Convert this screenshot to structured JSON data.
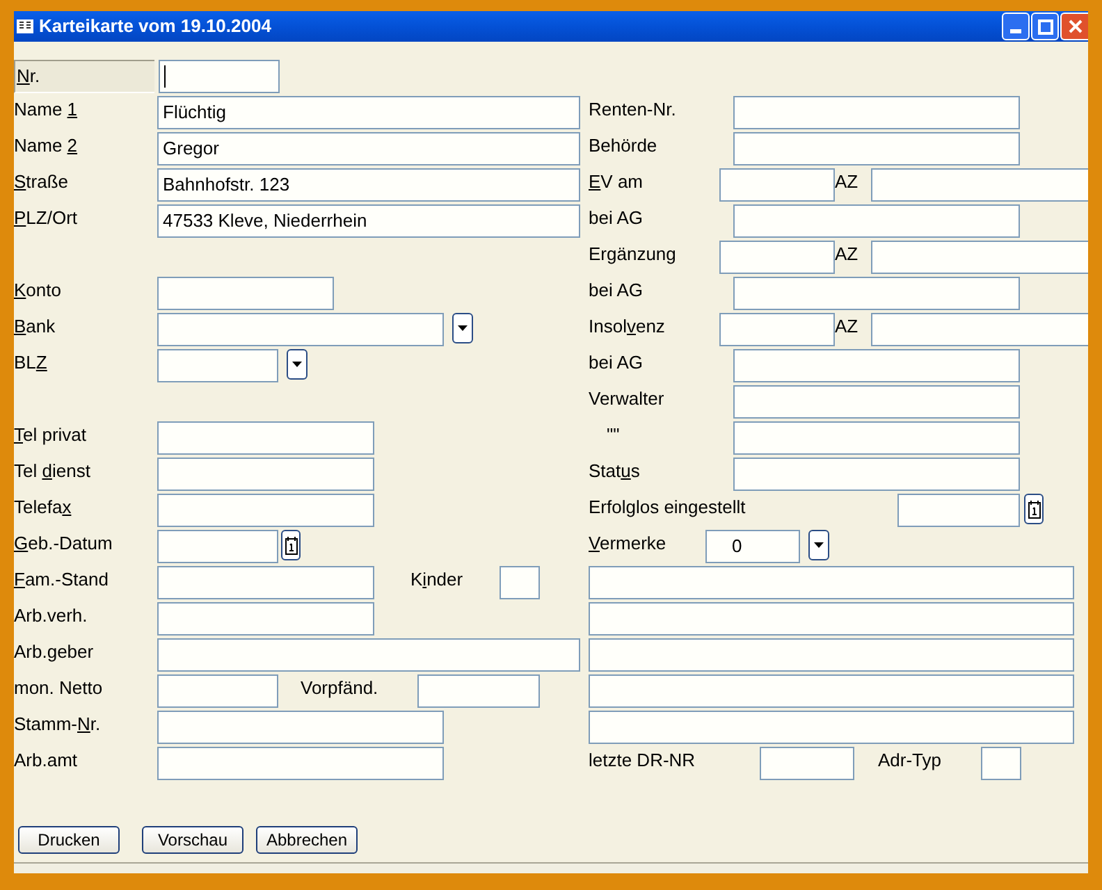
{
  "window": {
    "title": "Karteikarte vom 19.10.2004"
  },
  "left_groups": [
    [
      {
        "kind": "text",
        "label": {
          "key": "N",
          "post": "r."
        },
        "focused": true
      },
      {
        "kind": "text",
        "label": {
          "pre": "Name ",
          "key": "1"
        },
        "value": "Flüchtig"
      },
      {
        "kind": "text",
        "label": {
          "pre": "Name ",
          "key": "2"
        },
        "value": "Gregor"
      },
      {
        "kind": "text",
        "label": {
          "key": "S",
          "post": "traße"
        },
        "value": "Bahnhofstr. 123"
      },
      {
        "kind": "text",
        "label": {
          "key": "P",
          "post": "LZ/Ort"
        },
        "value": "47533 Kleve, Niederrhein"
      }
    ],
    [
      {
        "kind": "text",
        "label": {
          "key": "K",
          "post": "onto"
        }
      },
      {
        "kind": "dropdown",
        "label": {
          "key": "B",
          "post": "ank"
        }
      },
      {
        "kind": "dropdown",
        "label": {
          "pre": "BL",
          "key": "Z"
        }
      }
    ],
    [
      {
        "kind": "text",
        "label": {
          "key": "T",
          "post": "el privat"
        }
      },
      {
        "kind": "text",
        "label": {
          "pre": "Tel ",
          "key": "d",
          "post": "ienst"
        }
      },
      {
        "kind": "text",
        "label": {
          "pre": "Telefa",
          "key": "x"
        }
      },
      {
        "kind": "date",
        "label": {
          "key": "G",
          "post": "eb.-Datum"
        }
      },
      {
        "kind": "pair",
        "label": {
          "key": "F",
          "post": "am.-Stand"
        },
        "label2": {
          "pre": "K",
          "key": "i",
          "post": "nder"
        }
      },
      {
        "kind": "text",
        "label": {
          "pre": "Arb.verh."
        }
      },
      {
        "kind": "text",
        "label": {
          "pre": "Arb.geber"
        }
      },
      {
        "kind": "pair",
        "label": {
          "pre": "mon. Netto"
        },
        "label2": {
          "pre": "Vorpfänd."
        }
      },
      {
        "kind": "text",
        "label": {
          "pre": "Stamm-",
          "key": "N",
          "post": "r."
        }
      },
      {
        "kind": "text",
        "label": {
          "pre": "Arb.amt"
        }
      }
    ]
  ],
  "right_rows": [
    {
      "kind": "text",
      "label": {
        "pre": "Renten-Nr."
      }
    },
    {
      "kind": "text",
      "label": {
        "pre": "Behörde"
      }
    },
    {
      "kind": "az",
      "label": {
        "key": "E",
        "post": "V am"
      },
      "label2": {
        "pre": "AZ"
      }
    },
    {
      "kind": "text",
      "label": {
        "pre": "bei AG"
      }
    },
    {
      "kind": "az",
      "label": {
        "pre": "Ergänzung"
      },
      "label2": {
        "pre": "AZ"
      }
    },
    {
      "kind": "text",
      "label": {
        "pre": "bei AG"
      }
    },
    {
      "kind": "az",
      "label": {
        "pre": "Insol",
        "key": "v",
        "post": "enz"
      },
      "label2": {
        "pre": "AZ"
      }
    },
    {
      "kind": "text",
      "label": {
        "pre": "bei AG"
      }
    },
    {
      "kind": "text",
      "label": {
        "pre": "Verwalter"
      }
    },
    {
      "kind": "text",
      "label": {
        "pre": "\"\""
      }
    },
    {
      "kind": "text",
      "label": {
        "pre": "Stat",
        "key": "u",
        "post": "s"
      }
    },
    {
      "kind": "date",
      "label": {
        "pre": "Erfolglos eingestellt"
      }
    },
    {
      "kind": "dropdown",
      "label": {
        "key": "V",
        "post": "ermerke"
      },
      "value": "0"
    },
    {
      "kind": "blank"
    },
    {
      "kind": "blank"
    },
    {
      "kind": "blank"
    },
    {
      "kind": "blank"
    },
    {
      "kind": "blank"
    },
    {
      "kind": "pair",
      "label": {
        "pre": "letzte DR-NR"
      },
      "label2": {
        "pre": "Adr-Typ"
      }
    }
  ],
  "buttons": [
    "Drucken",
    "Vorschau",
    "Abbrechen"
  ]
}
